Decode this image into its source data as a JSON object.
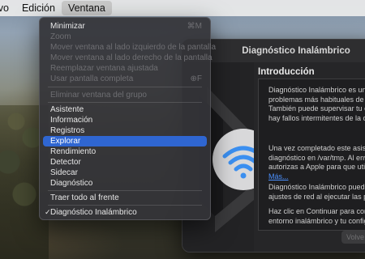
{
  "menubar": {
    "items": [
      "nivo",
      "Edición",
      "Ventana"
    ],
    "active_index": 2
  },
  "window_menu": {
    "items": [
      {
        "label": "Minimizar",
        "shortcut": "⌘M",
        "enabled": true
      },
      {
        "label": "Zoom",
        "enabled": false
      },
      {
        "label": "Mover ventana al lado izquierdo de la pantalla",
        "enabled": false
      },
      {
        "label": "Mover ventana al lado derecho de la pantalla",
        "enabled": false
      },
      {
        "label": "Reemplazar ventana ajustada",
        "enabled": false
      },
      {
        "label": "Usar pantalla completa",
        "shortcut": "⊕F",
        "enabled": false
      },
      {
        "label": "Eliminar ventana del grupo",
        "enabled": false
      },
      {
        "label": "Asistente",
        "enabled": true
      },
      {
        "label": "Información",
        "enabled": true
      },
      {
        "label": "Registros",
        "enabled": true
      },
      {
        "label": "Explorar",
        "enabled": true,
        "selected": true
      },
      {
        "label": "Rendimiento",
        "enabled": true
      },
      {
        "label": "Detector",
        "enabled": true
      },
      {
        "label": "Sidecar",
        "enabled": true
      },
      {
        "label": "Diagnóstico",
        "enabled": true
      },
      {
        "label": "Traer todo al frente",
        "enabled": true
      },
      {
        "label": "Diagnóstico Inalámbrico",
        "enabled": true,
        "checked": true,
        "check_mark": "✓"
      }
    ]
  },
  "app_window": {
    "title": "Diagnóstico Inalámbrico",
    "heading": "Introducción",
    "paragraphs": [
      [
        "Diagnóstico Inalámbrico es una ap",
        "problemas más habituales de las c",
        "También puede supervisar tu conc",
        "hay fallos intermitentes de la cone"
      ],
      [
        "Una vez completado este asistent",
        "diagnóstico en /var/tmp. Al enviar",
        "autorizas a Apple para que utilice"
      ],
      [
        "Diagnóstico Inalámbrico puede ca",
        "ajustes de red al ejecutar las prue"
      ],
      [
        "Haz clic en Continuar para comen",
        "entorno inalámbrico y tu configura"
      ]
    ],
    "link_text": "Más...",
    "back_button": "Volve",
    "colors": {
      "accent": "#2f66d1",
      "link": "#4a90ff",
      "wifi": "#3b8ff0"
    }
  }
}
